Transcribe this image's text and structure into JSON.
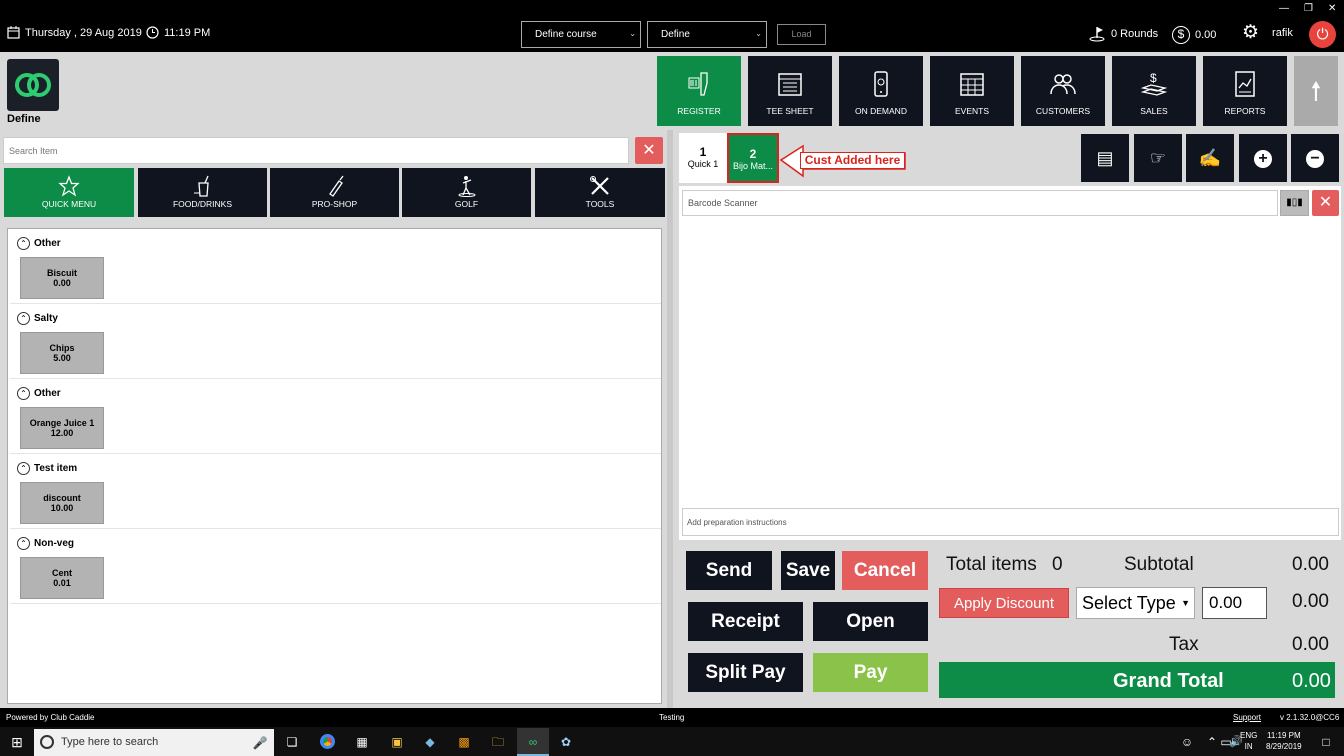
{
  "topbar": {
    "date": "Thursday ,  29 Aug 2019",
    "time": "11:19 PM",
    "course_select": "Define course",
    "define_select": "Define",
    "load_label": "Load",
    "rounds": "0 Rounds",
    "balance": "0.00",
    "user": "rafik"
  },
  "brand": {
    "name": "Define"
  },
  "nav": [
    {
      "label": "REGISTER",
      "icon": "barcode-scanner-icon"
    },
    {
      "label": "TEE SHEET",
      "icon": "calendar-list-icon"
    },
    {
      "label": "ON DEMAND",
      "icon": "mobile-icon"
    },
    {
      "label": "EVENTS",
      "icon": "calendar-grid-icon"
    },
    {
      "label": "CUSTOMERS",
      "icon": "users-icon"
    },
    {
      "label": "SALES",
      "icon": "money-icon"
    },
    {
      "label": "REPORTS",
      "icon": "report-icon"
    }
  ],
  "search": {
    "placeholder": "Search Item"
  },
  "categories": [
    {
      "label": "QUICK MENU",
      "icon": "star-icon"
    },
    {
      "label": "FOOD/DRINKS",
      "icon": "drink-icon"
    },
    {
      "label": "PRO-SHOP",
      "icon": "golf-bag-icon"
    },
    {
      "label": "GOLF",
      "icon": "golfer-icon"
    },
    {
      "label": "TOOLS",
      "icon": "tools-icon"
    }
  ],
  "groups": [
    {
      "name": "Other",
      "item": "Biscuit",
      "price": "0.00"
    },
    {
      "name": "Salty",
      "item": "Chips",
      "price": "5.00"
    },
    {
      "name": "Other",
      "item": "Orange Juice 1",
      "price": "12.00"
    },
    {
      "name": "Test item",
      "item": "discount",
      "price": "10.00"
    },
    {
      "name": "Non-veg",
      "item": "Cent",
      "price": "0.01"
    }
  ],
  "tabs": [
    {
      "num": "1",
      "label": "Quick 1"
    },
    {
      "num": "2",
      "label": "Bijo Mat..."
    }
  ],
  "annotation": "Cust Added here",
  "barcode": {
    "placeholder": "Barcode Scanner"
  },
  "prep": {
    "placeholder": "Add preparation instructions"
  },
  "actions": {
    "send": "Send",
    "save": "Save",
    "cancel": "Cancel",
    "receipt": "Receipt",
    "open": "Open",
    "split_pay": "Split Pay",
    "pay": "Pay"
  },
  "totals": {
    "total_items_label": "Total items",
    "total_items": "0",
    "subtotal_label": "Subtotal",
    "subtotal": "0.00",
    "apply_discount": "Apply Discount",
    "select_type": "Select Type",
    "discount_value": "0.00",
    "discount_amount": "0.00",
    "tax_label": "Tax",
    "tax": "0.00",
    "grand_label": "Grand Total",
    "grand": "0.00"
  },
  "footer": {
    "powered": "Powered by Club Caddie",
    "env": "Testing",
    "support": "Support",
    "version": "v 2.1.32.0@CC6"
  },
  "taskbar": {
    "search_placeholder": "Type here to search",
    "lang": "ENG",
    "region": "IN",
    "time": "11:19 PM",
    "date": "8/29/2019"
  }
}
